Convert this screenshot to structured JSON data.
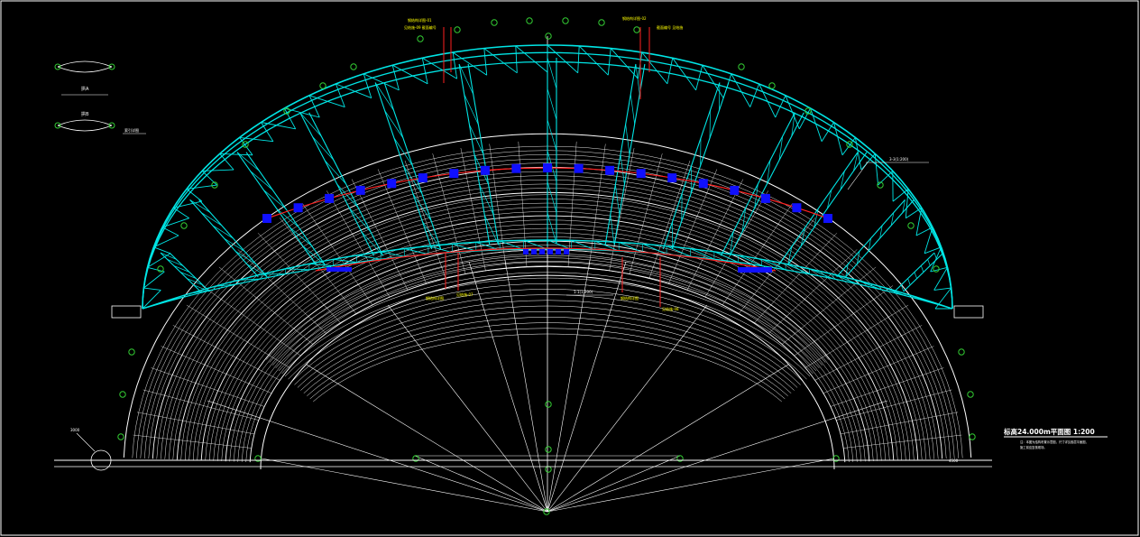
{
  "canvas": {
    "background": "#000000"
  },
  "colors": {
    "truss": "#00e5e5",
    "seating": "#ffffff",
    "red": "#ff2020",
    "blue": "#1010ff",
    "bubble": "#33cc33",
    "yellow": "#ffff00",
    "gray": "#bfbfbf"
  },
  "title": {
    "text": "标高24.000m平面图  1:200",
    "note1": "注：本图为结构布置示意图，尺寸详见各层平面图，",
    "note2": "施工前应复核现场。"
  },
  "callouts": {
    "top_left_a": "钢结构详图-01",
    "top_left_b": "见结施-09 截面编号",
    "top_right_a": "钢结构详图-02",
    "top_right_b": "截面编号 见结施",
    "bottom_left_a": "钢结构详图",
    "bottom_left_b": "见结施-07",
    "bottom_right_a": "钢结构详图",
    "bottom_right_b": "见结施-08",
    "section_right": "3-3(1:200)",
    "section_center": "1-1(1:200)",
    "legend_label": "索引详图"
  },
  "legend": {
    "label_a": "拱A",
    "label_b": "拱B"
  },
  "dimension": {
    "left": "3000",
    "right": "4500"
  }
}
